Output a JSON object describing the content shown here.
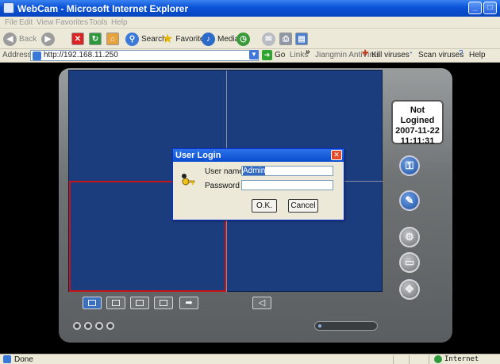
{
  "window": {
    "title": "WebCam - Microsoft Internet Explorer"
  },
  "menu": [
    "File",
    "Edit",
    "View",
    "Favorites",
    "Tools",
    "Help"
  ],
  "toolbar": {
    "back_label": "Back",
    "search_label": "Search",
    "favorites_label": "Favorites",
    "media_label": "Media"
  },
  "address": {
    "label": "Address",
    "url": "http://192.168.11.250",
    "go_label": "Go",
    "links_label": "Links",
    "chevron": "»",
    "link_items": [
      "Jiangmin AntiVirus",
      "Kill viruses",
      "Scan viruses",
      "Help"
    ]
  },
  "status_panel": {
    "line1": "Not Logined",
    "line2": "2007-11-22",
    "line3": "11:11:31"
  },
  "dialog": {
    "title": "User Login",
    "username_label": "User name",
    "username_value": "Admin",
    "password_label": "Password",
    "password_value": "",
    "ok_label": "O.K.",
    "cancel_label": "Cancel"
  },
  "statusbar": {
    "text": "Done",
    "zone": "Internet"
  },
  "colors": {
    "video_bg": "#1b3d7d",
    "selection": "#c61515",
    "title_bar": "#0a52d6"
  },
  "icons": {
    "side_buttons": [
      "key-icon",
      "wrench-icon",
      "settings-icon",
      "camera-icon",
      "ptz-icon"
    ],
    "bottom_buttons": [
      "single-view-icon",
      "quad-view-icon",
      "nine-view-icon",
      "sixteen-view-icon",
      "next-arrow-icon",
      "audio-icon"
    ]
  }
}
